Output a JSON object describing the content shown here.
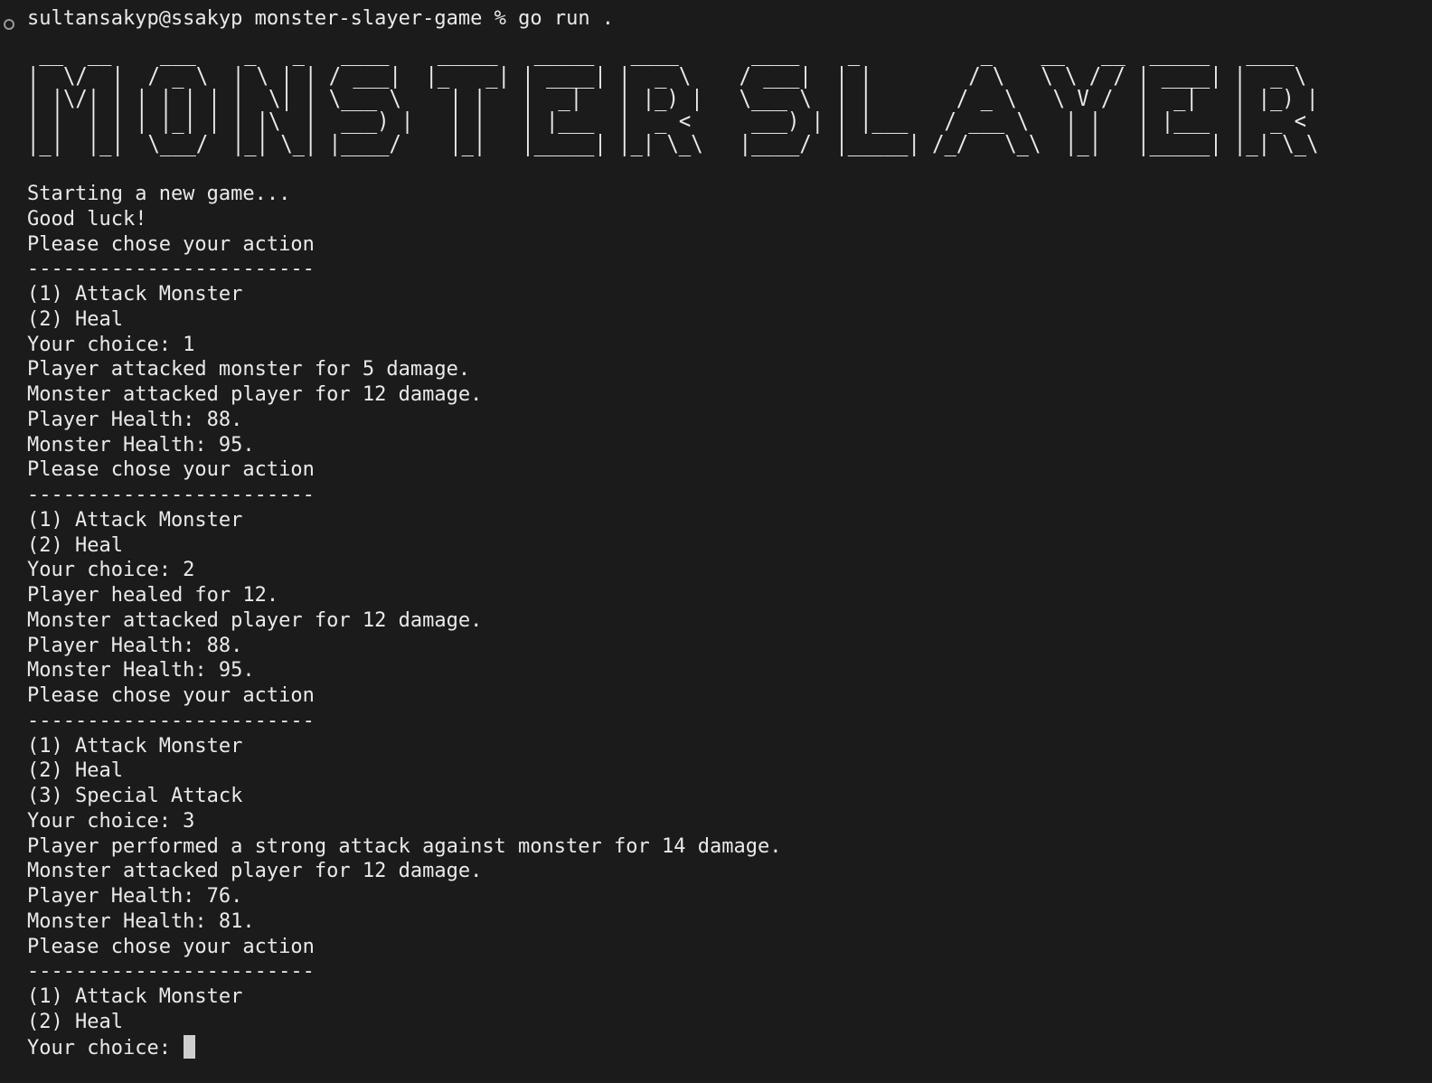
{
  "prompt": {
    "user_host": "sultansakyp@ssakyp",
    "directory": "monster-slayer-game",
    "symbol": "%",
    "command": "go run ."
  },
  "banner_text": "MONSTER SLAYER",
  "banner_ascii": [
    " __  __    ___    _   _   ____    _____   _____   ____      ____    _          _    __   __  _____   ____  ",
    "|  \\/  |  / _ \\  | \\ | | / ___|  |_   _| | ____| |  _ \\    / ___|  | |        / \\   \\ \\ / / | ____| |  _ \\ ",
    "| |\\/| | | | | | |  \\| | \\___ \\    | |   |  _|   | |_) |   \\___ \\  | |       / _ \\   \\ V /  |  _|   | |_) |",
    "| |  | | | |_| | | |\\  |  ___) |   | |   | |___  |  _ <     ___) | | |___   / ___ \\   | |   | |___  |  _ < ",
    "|_|  |_|  \\___/  |_| \\_| |____/    |_|   |_____| |_| \\_\\   |____/  |_____| /_/   \\_\\  |_|   |_____| |_| \\_\\"
  ],
  "output_lines": [
    "Starting a new game...",
    "Good luck!",
    "Please chose your action",
    "------------------------",
    "(1) Attack Monster",
    "(2) Heal",
    "Your choice: 1",
    "Player attacked monster for 5 damage.",
    "Monster attacked player for 12 damage.",
    "Player Health: 88.",
    "Monster Health: 95.",
    "Please chose your action",
    "------------------------",
    "(1) Attack Monster",
    "(2) Heal",
    "Your choice: 2",
    "Player healed for 12.",
    "Monster attacked player for 12 damage.",
    "Player Health: 88.",
    "Monster Health: 95.",
    "Please chose your action",
    "------------------------",
    "(1) Attack Monster",
    "(2) Heal",
    "(3) Special Attack",
    "Your choice: 3",
    "Player performed a strong attack against monster for 14 damage.",
    "Monster attacked player for 12 damage.",
    "Player Health: 76.",
    "Monster Health: 81.",
    "Please chose your action",
    "------------------------",
    "(1) Attack Monster",
    "(2) Heal"
  ],
  "input_prompt": "Your choice: ",
  "input_value": "",
  "colors": {
    "background": "#1b1b1b",
    "foreground": "#eaeaea",
    "cursor": "#cfcfcf",
    "status_circle": "#9a9a9a"
  },
  "icons": {
    "status": "circle-outline-icon"
  }
}
